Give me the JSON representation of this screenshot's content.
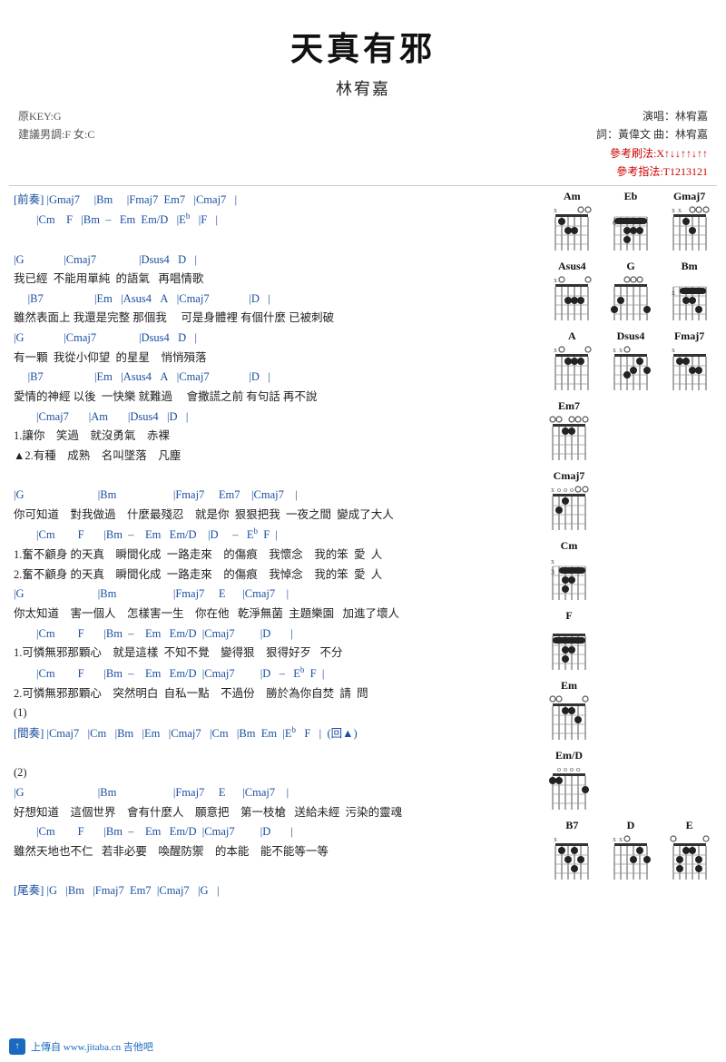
{
  "title": "天真有邪",
  "singer": "林宥嘉",
  "meta": {
    "key": "原KEY:G",
    "suggest": "建議男調:F 女:C",
    "performer": "演唱：林宥嘉",
    "lyrics_by": "詞：黃偉文  曲：林宥嘉",
    "strum_label1": "參考刷法:X↑↓↓↑↑↓↑↑",
    "strum_label2": "參考指法:T1213121"
  },
  "footer": {
    "upload": "上傳自",
    "website": "www.jitaba.cn 吉他吧"
  },
  "lines": [
    {
      "type": "chord",
      "text": "[前奏] |Gmaj7     |Bm     |Fmaj7  Em7   |Cmaj7   |"
    },
    {
      "type": "chord",
      "text": "        |Cm    F   |Bm  –   Em  Em/D   |E♭   |F   |"
    },
    {
      "type": "space"
    },
    {
      "type": "chord",
      "text": "|G              |Cmaj7               |Dsus4   D   |"
    },
    {
      "type": "lyric",
      "text": "我已經  不能用單純  的語氣   再唱情歌"
    },
    {
      "type": "chord",
      "text": "     |B7                  |Em   |Asus4   A   |Cmaj7              |D   |"
    },
    {
      "type": "lyric",
      "text": "雖然表面上 我還是完整 那個我     可是身體裡 有個什麼 已被刺破"
    },
    {
      "type": "chord",
      "text": "|G              |Cmaj7               |Dsus4   D   |"
    },
    {
      "type": "lyric",
      "text": "有一顆  我從小仰望  的星星    悄悄殞落"
    },
    {
      "type": "chord",
      "text": "     |B7                  |Em   |Asus4   A   |Cmaj7              |D   |"
    },
    {
      "type": "lyric",
      "text": "愛情的神經 以後  一快樂 就難過     會撒謊之前 有句話 再不說"
    },
    {
      "type": "chord",
      "text": "        |Cmaj7       |Am       |Dsus4   |D   |"
    },
    {
      "type": "lyric",
      "text": "1.讓你    笑過    就沒勇氣    赤裸"
    },
    {
      "type": "lyric",
      "text": "▲2.有種    成熟    名叫墜落    凡塵"
    },
    {
      "type": "space"
    },
    {
      "type": "chord",
      "text": "|G                          |Bm                    |Fmaj7     Em7    |Cmaj7    |"
    },
    {
      "type": "lyric",
      "text": "你可知道    對我做過    什麼最殘忍    就是你  狠狠把我  一夜之間  變成了大人"
    },
    {
      "type": "chord",
      "text": "        |Cm        F       |Bm  –    Em   Em/D    |D     –   E♭  F  |"
    },
    {
      "type": "lyric",
      "text": "1.奮不顧身 的天真    瞬間化成  一路走來    的傷痕    我懷念    我的笨  愛  人"
    },
    {
      "type": "lyric",
      "text": "2.奮不顧身 的天真    瞬間化成  一路走來    的傷痕    我悼念    我的笨  愛  人"
    },
    {
      "type": "chord",
      "text": "|G                          |Bm                    |Fmaj7     E      |Cmaj7    |"
    },
    {
      "type": "lyric",
      "text": "你太知道    害一個人    怎樣害一生    你在他   乾淨無菌  主題樂園   加進了壞人"
    },
    {
      "type": "chord",
      "text": "        |Cm        F       |Bm  –    Em   Em/D  |Cmaj7         |D       |"
    },
    {
      "type": "lyric",
      "text": "1.可憐無邪那顆心    就是這樣  不知不覺    變得狠    狠得好歹   不分"
    },
    {
      "type": "chord",
      "text": "        |Cm        F       |Bm  –    Em   Em/D  |Cmaj7         |D   –   E♭  F  |"
    },
    {
      "type": "lyric",
      "text": "2.可憐無邪那顆心    突然明白  自私一點    不過份    勝於為你自焚  請  問"
    },
    {
      "type": "lyric",
      "text": "(1)"
    },
    {
      "type": "chord",
      "text": "[間奏] |Cmaj7   |Cm   |Bm   |Em   |Cmaj7   |Cm   |Bm  Em  |E♭   F   |  (回▲)"
    },
    {
      "type": "space"
    },
    {
      "type": "lyric",
      "text": "(2)"
    },
    {
      "type": "chord",
      "text": "|G                          |Bm                    |Fmaj7     E      |Cmaj7    |"
    },
    {
      "type": "lyric",
      "text": "好想知道    這個世界    會有什麼人    願意把    第一枝槍   送給未經  污染的靈魂"
    },
    {
      "type": "chord",
      "text": "        |Cm        F       |Bm  –    Em   Em/D  |Cmaj7         |D       |"
    },
    {
      "type": "lyric",
      "text": "雖然天地也不仁   若非必要    喚醒防禦    的本能    能不能等一等"
    },
    {
      "type": "space"
    },
    {
      "type": "chord",
      "text": "[尾奏] |G   |Bm   |Fmaj7  Em7  |Cmaj7   |G   |"
    }
  ],
  "chords": [
    {
      "name": "Am",
      "fret": "",
      "fingers": [
        [
          1,
          1,
          0
        ],
        [
          2,
          2,
          3
        ],
        [
          2,
          3,
          4
        ],
        [
          0,
          4,
          0
        ],
        [
          0,
          5,
          0
        ],
        [
          0,
          6,
          0
        ]
      ],
      "open": [
        0,
        0,
        0,
        0,
        1,
        1
      ],
      "mute": [
        1,
        0,
        0,
        0,
        0,
        0
      ]
    },
    {
      "name": "Eb",
      "fret": "6",
      "fingers": [
        [
          1,
          1,
          0
        ],
        [
          1,
          2,
          0
        ],
        [
          2,
          3,
          0
        ],
        [
          3,
          4,
          0
        ],
        [
          3,
          5,
          0
        ],
        [
          3,
          6,
          0
        ]
      ],
      "barre": true
    },
    {
      "name": "Gmaj7",
      "fret": "",
      "fingers": []
    },
    {
      "name": "Asus4",
      "fret": "",
      "fingers": []
    },
    {
      "name": "G",
      "fret": "",
      "fingers": []
    },
    {
      "name": "Bm",
      "fret": "",
      "fingers": []
    },
    {
      "name": "A",
      "fret": "",
      "fingers": []
    },
    {
      "name": "Dsus4",
      "fret": "",
      "fingers": []
    },
    {
      "name": "Fmaj7",
      "fret": "",
      "fingers": []
    },
    {
      "name": "Em7",
      "fret": "",
      "fingers": []
    },
    {
      "name": "Cmaj7",
      "fret": "",
      "fingers": []
    },
    {
      "name": "Cm",
      "fret": "3",
      "fingers": []
    },
    {
      "name": "F",
      "fret": "",
      "fingers": []
    },
    {
      "name": "Em",
      "fret": "",
      "fingers": []
    },
    {
      "name": "Em/D",
      "fret": "",
      "fingers": []
    },
    {
      "name": "B7",
      "fret": "",
      "fingers": []
    },
    {
      "name": "D",
      "fret": "",
      "fingers": []
    },
    {
      "name": "E",
      "fret": "",
      "fingers": []
    }
  ]
}
